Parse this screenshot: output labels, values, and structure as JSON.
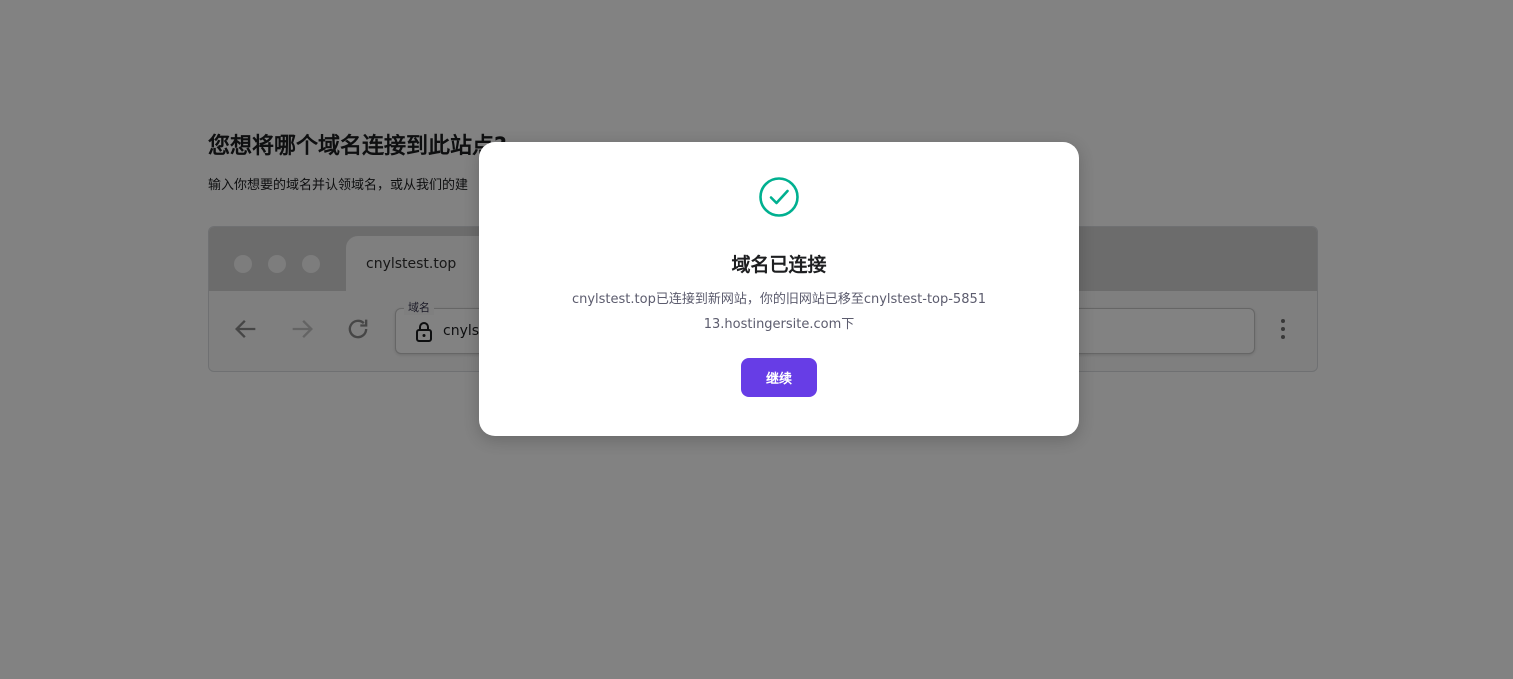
{
  "page": {
    "title": "您想将哪个域名连接到此站点?",
    "subtitle": "输入你想要的域名并认领域名，或从我们的建"
  },
  "browser": {
    "tab_label": "cnylstest.top",
    "address_legend": "域名",
    "address_text": "cnylst"
  },
  "icons": {
    "back": "arrow-left-icon",
    "forward": "arrow-right-icon",
    "reload": "reload-icon",
    "lock": "lock-icon",
    "menu": "kebab-menu-icon",
    "success": "check-circle-icon"
  },
  "modal": {
    "title": "域名已连接",
    "message": "cnylstest.top已连接到新网站，你的旧网站已移至cnylstest-top-585113.hostingersite.com下",
    "continue_label": "继续"
  },
  "colors": {
    "primary": "#673de6",
    "success": "#00b090",
    "overlay": "rgba(0,0,0,0.49)"
  }
}
